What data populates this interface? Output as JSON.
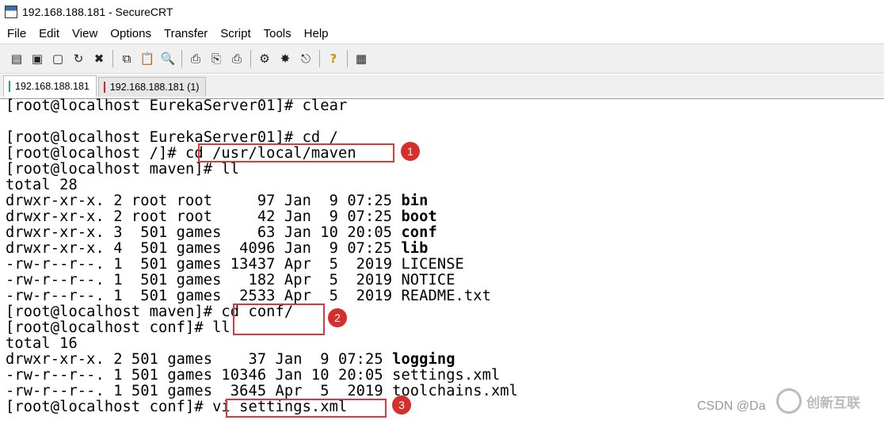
{
  "window": {
    "title": "192.168.188.181 - SecureCRT"
  },
  "menu": [
    "File",
    "Edit",
    "View",
    "Options",
    "Transfer",
    "Script",
    "Tools",
    "Help"
  ],
  "toolbar": {
    "icons": [
      "connect-icon",
      "quick-connect-icon",
      "connect-tab-icon",
      "reconnect-icon",
      "disconnect-icon",
      "copy-icon",
      "paste-icon",
      "find-icon",
      "print-setup-icon",
      "print-selection-icon",
      "print-icon",
      "session-options-icon",
      "global-options-icon",
      "keymap-icon",
      "help-icon",
      "sftp-icon"
    ]
  },
  "tabs": [
    {
      "label": "192.168.188.181",
      "marker_color": "#22b14c"
    },
    {
      "label": "192.168.188.181 (1)",
      "marker_color": "#e02020"
    }
  ],
  "terminal": {
    "lines": [
      {
        "text": "[root@localhost EurekaServer01]# clear"
      },
      {
        "text": ""
      },
      {
        "text": "[root@localhost EurekaServer01]# cd /"
      },
      {
        "text": "[root@localhost /]# cd /usr/local/maven"
      },
      {
        "text": "[root@localhost maven]# ll"
      },
      {
        "text": "total 28"
      },
      {
        "text": "drwxr-xr-x. 2 root root     97 Jan  9 07:25 ",
        "name": "bin",
        "bold": true
      },
      {
        "text": "drwxr-xr-x. 2 root root     42 Jan  9 07:25 ",
        "name": "boot",
        "bold": true
      },
      {
        "text": "drwxr-xr-x. 3  501 games    63 Jan 10 20:05 ",
        "name": "conf",
        "bold": true
      },
      {
        "text": "drwxr-xr-x. 4  501 games  4096 Jan  9 07:25 ",
        "name": "lib",
        "bold": true
      },
      {
        "text": "-rw-r--r--. 1  501 games 13437 Apr  5  2019 ",
        "name": "LICENSE",
        "bold": false
      },
      {
        "text": "-rw-r--r--. 1  501 games   182 Apr  5  2019 ",
        "name": "NOTICE",
        "bold": false
      },
      {
        "text": "-rw-r--r--. 1  501 games  2533 Apr  5  2019 ",
        "name": "README.txt",
        "bold": false
      },
      {
        "text": "[root@localhost maven]# cd conf/"
      },
      {
        "text": "[root@localhost conf]# ll"
      },
      {
        "text": "total 16"
      },
      {
        "text": "drwxr-xr-x. 2 501 games    37 Jan  9 07:25 ",
        "name": "logging",
        "bold": true
      },
      {
        "text": "-rw-r--r--. 1 501 games 10346 Jan 10 20:05 ",
        "name": "settings.xml",
        "bold": false
      },
      {
        "text": "-rw-r--r--. 1 501 games  3645 Apr  5  2019 ",
        "name": "toolchains.xml",
        "bold": false
      },
      {
        "text": "[root@localhost conf]# vi settings.xml"
      }
    ]
  },
  "annotations": [
    {
      "number": "1",
      "target": "cd /usr/local/maven"
    },
    {
      "number": "2",
      "target": "cd conf/ ll"
    },
    {
      "number": "3",
      "target": "vi settings.xml"
    }
  ],
  "watermark": {
    "text": "CSDN @Da",
    "logo_text": "创新互联"
  },
  "colors": {
    "highlight": "#d93a3a",
    "badge": "#d62d2d"
  }
}
